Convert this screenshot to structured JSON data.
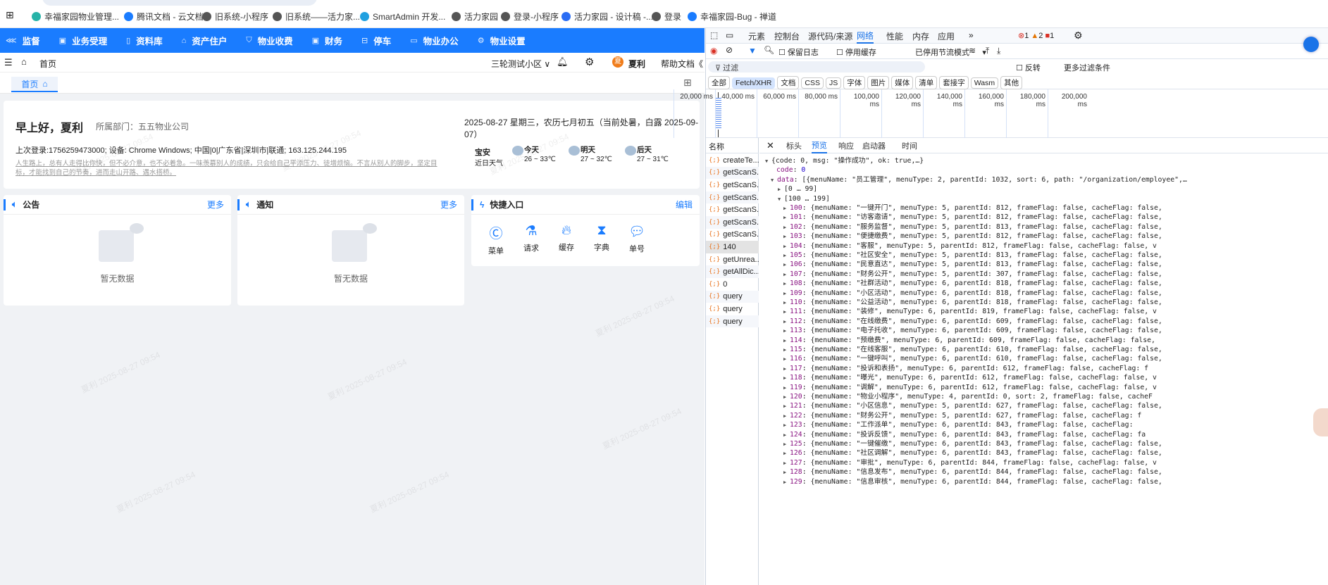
{
  "bookmarks": [
    "幸福家园物业管理...",
    "腾讯文档 - 云文档",
    "旧系统-小程序",
    "旧系统——活力家...",
    "SmartAdmin 开发...",
    "活力家园",
    "登录-小程序",
    "活力家园 - 设计稿 -...",
    "登录",
    "幸福家园-Bug - 禅道"
  ],
  "nav": [
    {
      "icon": "share-icon",
      "label": "监督"
    },
    {
      "icon": "clipboard-icon",
      "label": "业务受理"
    },
    {
      "icon": "file-icon",
      "label": "资料库"
    },
    {
      "icon": "home-icon",
      "label": "资产住户"
    },
    {
      "icon": "shield-icon",
      "label": "物业收费"
    },
    {
      "icon": "wallet-icon",
      "label": "财务"
    },
    {
      "icon": "car-icon",
      "label": "停车"
    },
    {
      "icon": "monitor-icon",
      "label": "物业办公"
    },
    {
      "icon": "gear-icon",
      "label": "物业设置"
    }
  ],
  "header": {
    "breadcrumb": "首页",
    "community": "三轮测试小区",
    "avatar_char": "夏",
    "user": "夏利",
    "help": "帮助文档"
  },
  "tab": "首页",
  "greeting": {
    "title": "早上好，夏利",
    "dept_label": "所属部门：",
    "dept": "五五物业公司",
    "date": "2025-08-27 星期三，农历七月初五（当前处暑，白露 2025-09-07）",
    "last_login": "上次登录:1756259473000; 设备: Chrome Windows; 中国|0|广东省|深圳市|联通; 163.125.244.195",
    "motto": "人生路上，总有人走得比你快，但不必介意，也不必着急。一味羡慕别人的成绩，只会给自己平添压力、徒增烦恼。不言从别人的脚步，坚定目标，才能找到自己的节奏，进而走山开路、遇水搭桥。"
  },
  "weather": {
    "city": "宝安",
    "sub": "近日天气",
    "days": [
      {
        "label": "今天",
        "temp": "26 ~ 33℃"
      },
      {
        "label": "明天",
        "temp": "27 ~ 32℃"
      },
      {
        "label": "后天",
        "temp": "27 ~ 31℃"
      }
    ]
  },
  "notice": {
    "title": "公告",
    "more": "更多",
    "empty": "暂无数据"
  },
  "inform": {
    "title": "通知",
    "more": "更多",
    "empty": "暂无数据"
  },
  "quick": {
    "title": "快捷入口",
    "edit": "编辑",
    "items": [
      "菜单",
      "请求",
      "缓存",
      "字典",
      "单号"
    ]
  },
  "watermark": "夏利 2025-08-27 09:54",
  "devtools": {
    "tabs": [
      "元素",
      "控制台",
      "源代码/来源",
      "网络",
      "性能",
      "内存",
      "应用"
    ],
    "errors": "1",
    "warnings": "2",
    "issues": "1",
    "toolbar": {
      "preserve_log": "保留日志",
      "disable_cache": "停用缓存",
      "throttle": "已停用节流模式"
    },
    "filter": {
      "placeholder": "过滤",
      "invert": "反转",
      "more": "更多过滤条件"
    },
    "types": [
      "全部",
      "Fetch/XHR",
      "文档",
      "CSS",
      "JS",
      "字体",
      "图片",
      "媒体",
      "清单",
      "套接字",
      "Wasm",
      "其他"
    ],
    "timeline": [
      "20,000 ms",
      "40,000 ms",
      "60,000 ms",
      "80,000 ms",
      "100,000 ms",
      "120,000 ms",
      "140,000 ms",
      "160,000 ms",
      "180,000 ms",
      "200,000 ms"
    ],
    "name_header": "名称",
    "requests": [
      "createTe...",
      "getScanS...",
      "getScanS...",
      "getScanS...",
      "getScanS...",
      "getScanS...",
      "getScanS...",
      "140",
      "getUnrea...",
      "getAllDic...",
      "0",
      "query",
      "query",
      "query"
    ],
    "detail_tabs": [
      "标头",
      "预览",
      "响应",
      "启动器",
      "时间"
    ],
    "preview": {
      "root": "{code: 0, msg: \"操作成功\", ok: true,…}",
      "code_key": "code",
      "code_val": "0",
      "data_key": "data",
      "data_val": "[{menuName: \"员工管理\", menuType: 2, parentId: 1032, sort: 6, path: \"/organization/employee\",…",
      "group0": "[0 … 99]",
      "group1": "[100 … 199]",
      "rows": [
        [
          "100",
          "{menuName: \"一键开门\", menuType: 5, parentId: 812, frameFlag: false, cacheFlag: false,"
        ],
        [
          "101",
          "{menuName: \"访客邀请\", menuType: 5, parentId: 812, frameFlag: false, cacheFlag: false,"
        ],
        [
          "102",
          "{menuName: \"服务监督\", menuType: 5, parentId: 813, frameFlag: false, cacheFlag: false,"
        ],
        [
          "103",
          "{menuName: \"便捷缴费\", menuType: 5, parentId: 812, frameFlag: false, cacheFlag: false,"
        ],
        [
          "104",
          "{menuName: \"客服\", menuType: 5, parentId: 812, frameFlag: false, cacheFlag: false, v"
        ],
        [
          "105",
          "{menuName: \"社区安全\", menuType: 5, parentId: 813, frameFlag: false, cacheFlag: false,"
        ],
        [
          "106",
          "{menuName: \"民意直达\", menuType: 5, parentId: 813, frameFlag: false, cacheFlag: false,"
        ],
        [
          "107",
          "{menuName: \"财务公开\", menuType: 5, parentId: 307, frameFlag: false, cacheFlag: false,"
        ],
        [
          "108",
          "{menuName: \"社群活动\", menuType: 6, parentId: 818, frameFlag: false, cacheFlag: false,"
        ],
        [
          "109",
          "{menuName: \"小区活动\", menuType: 6, parentId: 818, frameFlag: false, cacheFlag: false,"
        ],
        [
          "110",
          "{menuName: \"公益活动\", menuType: 6, parentId: 818, frameFlag: false, cacheFlag: false,"
        ],
        [
          "111",
          "{menuName: \"装修\", menuType: 6, parentId: 819, frameFlag: false, cacheFlag: false, v"
        ],
        [
          "112",
          "{menuName: \"在线缴费\", menuType: 6, parentId: 609, frameFlag: false, cacheFlag: false,"
        ],
        [
          "113",
          "{menuName: \"电子托收\", menuType: 6, parentId: 609, frameFlag: false, cacheFlag: false,"
        ],
        [
          "114",
          "{menuName: \"预缴费\", menuType: 6, parentId: 609, frameFlag: false, cacheFlag: false,"
        ],
        [
          "115",
          "{menuName: \"在线客服\", menuType: 6, parentId: 610, frameFlag: false, cacheFlag: false,"
        ],
        [
          "116",
          "{menuName: \"一键呼叫\", menuType: 6, parentId: 610, frameFlag: false, cacheFlag: false,"
        ],
        [
          "117",
          "{menuName: \"投诉和表扬\", menuType: 6, parentId: 612, frameFlag: false, cacheFlag: f"
        ],
        [
          "118",
          "{menuName: \"曝光\", menuType: 6, parentId: 612, frameFlag: false, cacheFlag: false, v"
        ],
        [
          "119",
          "{menuName: \"调解\", menuType: 6, parentId: 612, frameFlag: false, cacheFlag: false, v"
        ],
        [
          "120",
          "{menuName: \"物业小程序\", menuType: 4, parentId: 0, sort: 2, frameFlag: false, cacheF"
        ],
        [
          "121",
          "{menuName: \"小区信息\", menuType: 5, parentId: 627, frameFlag: false, cacheFlag: false,"
        ],
        [
          "122",
          "{menuName: \"财务公开\", menuType: 5, parentId: 627, frameFlag: false, cacheFlag: f"
        ],
        [
          "123",
          "{menuName: \"工作派单\", menuType: 6, parentId: 843, frameFlag: false, cacheFlag:"
        ],
        [
          "124",
          "{menuName: \"投诉反馈\", menuType: 6, parentId: 843, frameFlag: false, cacheFlag: fa"
        ],
        [
          "125",
          "{menuName: \"一键催缴\", menuType: 6, parentId: 843, frameFlag: false, cacheFlag: false,"
        ],
        [
          "126",
          "{menuName: \"社区调解\", menuType: 6, parentId: 843, frameFlag: false, cacheFlag: false,"
        ],
        [
          "127",
          "{menuName: \"审批\", menuType: 6, parentId: 844, frameFlag: false, cacheFlag: false, v"
        ],
        [
          "128",
          "{menuName: \"信息发布\", menuType: 6, parentId: 844, frameFlag: false, cacheFlag: false,"
        ],
        [
          "129",
          "{menuName: \"信息审核\", menuType: 6, parentId: 844, frameFlag: false, cacheFlag: false,"
        ]
      ]
    }
  },
  "colors": {
    "brand": "#1a7cff",
    "avatar": "#f07c1a",
    "json_key": "#881280"
  }
}
